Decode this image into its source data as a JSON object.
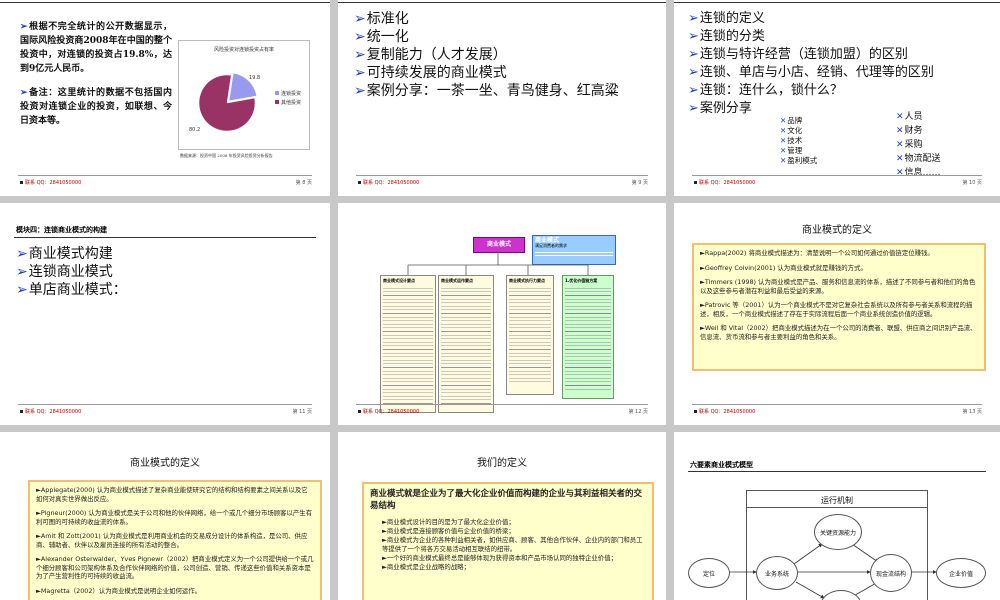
{
  "footer_contact": "联系 QQ：2841050000",
  "slide1": {
    "para1": "根据不完全统计的公开数据显示，国际风险投资商2008年在中国的整个投资中，对连锁的投资占19.8%，达到9亿元人民币。",
    "para2": "备注：这里统计的数据不包括国内投资对连锁企业的投资，如联想、今日资本等。",
    "chart_title": "风险投资对连锁投资占有率",
    "source_note": "数据来源：投资中国 2008 年投资风险投资分析报告",
    "page": "第 8 页",
    "chart_data": {
      "type": "pie",
      "title": "风险投资对连锁投资占有率",
      "categories": [
        "连锁投资",
        "其他投资"
      ],
      "values": [
        19.8,
        80.2
      ],
      "value_labels": [
        "19.8",
        "80.2"
      ],
      "colors": [
        "#9999ee",
        "#993366"
      ],
      "legend_position": "right"
    }
  },
  "slide2": {
    "items": [
      "标准化",
      "统一化",
      "复制能力（人才发展）",
      "可持续发展的商业模式",
      "案例分享：一茶一坐、青鸟健身、红高粱"
    ],
    "page": "第 9 页"
  },
  "slide3": {
    "items": [
      "连锁的定义",
      "连锁的分类",
      "连锁与特许经营（连锁加盟）的区别",
      "连锁、单店与小店、经销、代理等的区别",
      "连锁：连什么，锁什么？",
      "案例分享"
    ],
    "left_sub": [
      "品牌",
      "文化",
      "技术",
      "管理",
      "盈利模式"
    ],
    "right_sub": [
      "人员",
      "财务",
      "采购",
      "物流配送",
      "信息……"
    ],
    "page": "第 10 页"
  },
  "slide4": {
    "title": "模块四：连锁商业模式的构建",
    "items": [
      "商业模式构建",
      "连锁商业模式",
      "单店商业模式："
    ],
    "page": "第 11 页"
  },
  "slide5": {
    "root": "商业模式",
    "side_note_title": "商业模式",
    "side_note_sub": "满足消费者的需求",
    "col_titles": [
      "商业模式设计要点",
      "商业模式运作要点",
      "商业模式执行力要点",
      "1.优化价值链方案"
    ],
    "page": "第 12 页"
  },
  "slide6": {
    "title": "商业模式的定义",
    "paras": [
      "Rappa(2002) 将商业模式描述为：清楚说明一个公司如何通过价值链定位赚钱。",
      "Geoffrey Colvin(2001) 认为商业模式就是赚钱的方式。",
      "Timmers (1998) 认为商业模式是产品、服务和信息流的体系，描述了不同参与者和他们的角色以及这些参与者潜在利益和最后受益的来源。",
      "Patrovic 等（2001）认为一个商业模式不是对它复杂社会系统以及所有参与者关系和流程的描述，相反，一个商业模式描述了存在于实际流程后面一个商业系统创造价值的逻辑。",
      "Weil 和 Vital（2002）把商业模式描述为在一个公司的消费者、联盟、供应商之间识别产品流、信息流、货币流和参与者主要利益的角色和关系。"
    ],
    "page": "第 13 页"
  },
  "slide7": {
    "title": "商业模式的定义",
    "paras": [
      "Applegate(2000) 认为商业模式描述了复杂商业能使研究它的结构和结构要素之间关系以及它如何对真实世界做出反应。",
      "Pigneur(2000) 认为商业模式是关于公司和他的伙伴网络，给一个或几个细分市场顾客以产生有利可图的可持续的收益流的体系。",
      "Amit 和 Zott(2001) 认为商业模式是利用商业机会的交易成分设计的体系构造，是公司、供应商、辅助者、伙伴以及雇员连接的所有活动的整合。",
      "Alexander Osterwalder、Yves Pignewr（2002）把商业模式定义为一个公司提供给一个或几个细分顾客和公司架构体系及合作伙伴网络的价值，公司创造、营销、传递这些价值和关系资本是为了产生营利性的可持续的收益流。",
      "Magretta（2002）认为商业模式是说明企业如何运作。"
    ]
  },
  "slide8": {
    "title": "我们的定义",
    "lead": "商业模式就是企业为了最大化企业价值而构建的企业与其利益相关者的交易结构",
    "bullets": [
      "商业模式设计的目的是为了最大化企业价值；",
      "商业模式是连接顾客价值与企业价值的桥梁；",
      "商业模式为企业的各种利益相关者，如供应商、顾客、其他合作伙伴、企业内的部门和员工等提供了一个将各方交易活动相互联结的纽带。",
      "一个好的商业模式最终总是能够体现为获得资本和产品市场认同的独特企业价值；",
      "商业模式是企业战略的战略；"
    ]
  },
  "slide9": {
    "title": "六要素商业模式模型",
    "frame_title": "运行机制",
    "nodes": [
      "关键资源能力",
      "定位",
      "业务系统",
      "现金流结构",
      "企业价值"
    ]
  }
}
